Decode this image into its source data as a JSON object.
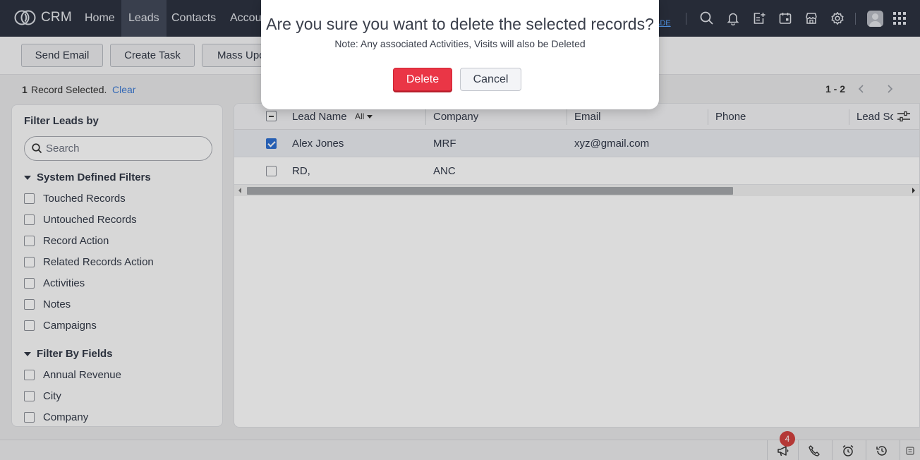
{
  "app": {
    "name": "CRM",
    "logo_icon": "crm-logo-icon"
  },
  "nav": {
    "tabs": [
      {
        "label": "Home",
        "active": false
      },
      {
        "label": "Leads",
        "active": true
      },
      {
        "label": "Contacts",
        "active": false
      },
      {
        "label": "Accou",
        "active": false
      }
    ],
    "trial_text": "e",
    "trial_link": "ADE",
    "icons": [
      "search-icon",
      "bell-icon",
      "add-note-icon",
      "calendar-icon",
      "marketplace-icon",
      "gear-icon",
      "avatar",
      "apps-grid-icon"
    ]
  },
  "toolbar": {
    "send_email": "Send Email",
    "create_task": "Create Task",
    "mass_update": "Mass Upc"
  },
  "selection": {
    "count": "1",
    "text": "Record Selected.",
    "clear": "Clear",
    "range": "1 - 2"
  },
  "filter": {
    "title": "Filter Leads by",
    "search_placeholder": "Search",
    "system_section": "System Defined Filters",
    "system_items": [
      "Touched Records",
      "Untouched Records",
      "Record Action",
      "Related Records Action",
      "Activities",
      "Notes",
      "Campaigns"
    ],
    "fields_section": "Filter By Fields",
    "field_items": [
      "Annual Revenue",
      "City",
      "Company"
    ]
  },
  "table": {
    "columns": [
      "Lead Name",
      "Company",
      "Email",
      "Phone",
      "Lead So"
    ],
    "name_filter": "All",
    "rows": [
      {
        "name": "Alex Jones",
        "company": "MRF",
        "email": "xyz@gmail.com",
        "phone": "",
        "checked": true
      },
      {
        "name": "RD,",
        "company": "ANC",
        "email": "",
        "phone": "",
        "checked": false
      }
    ]
  },
  "bottombar": {
    "badge": "4",
    "icons": [
      "megaphone-icon",
      "dial-icon",
      "alarm-icon",
      "history-icon",
      "notes-icon"
    ]
  },
  "modal": {
    "title": "Are you sure you want to delete the selected records?",
    "note": "Note: Any associated Activities, Visits will also be Deleted",
    "delete_label": "Delete",
    "cancel_label": "Cancel"
  },
  "colors": {
    "nav_bg": "#2d3340",
    "nav_active": "#434a5a",
    "delete_red": "#ea3646",
    "link_blue": "#3d7bd4",
    "checkbox_blue": "#2e6fd1",
    "badge_red": "#d2423f"
  }
}
